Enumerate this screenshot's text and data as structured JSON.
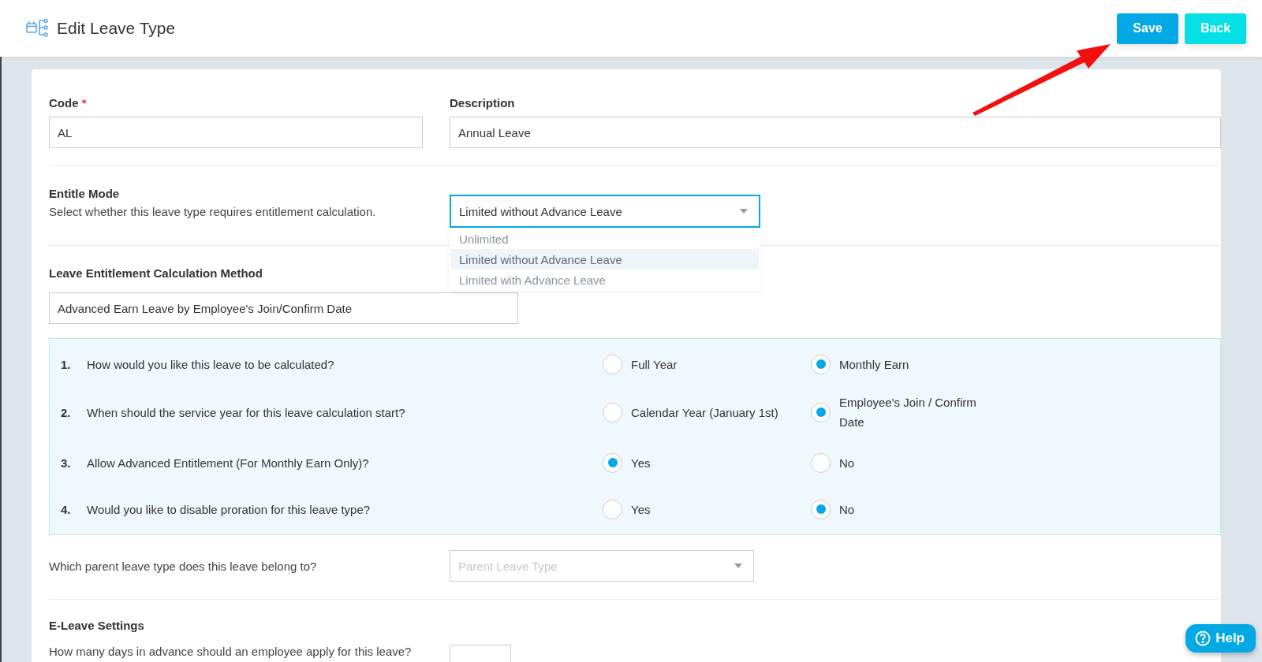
{
  "header": {
    "title": "Edit Leave Type",
    "buttons": [
      {
        "label": "Save",
        "kind": "primary"
      },
      {
        "label": "Back",
        "kind": "secondary"
      }
    ]
  },
  "code": {
    "label": "Code",
    "required_mark": "*",
    "value": "AL"
  },
  "description": {
    "label": "Description",
    "value": "Annual Leave"
  },
  "entitle_mode": {
    "title": "Entitle Mode",
    "hint": "Select whether this leave type requires entitlement calculation.",
    "value": "Limited without Advance Leave",
    "options": [
      {
        "label": "Unlimited",
        "selected": false
      },
      {
        "label": "Limited without Advance Leave",
        "selected": true
      },
      {
        "label": "Limited with Advance Leave",
        "selected": false
      }
    ]
  },
  "calculation_method": {
    "title": "Leave Entitlement Calculation Method",
    "value": "Advanced Earn Leave by Employee's Join/Confirm Date"
  },
  "questions": [
    {
      "number": "1.",
      "text": "How would you like this leave to be calculated?",
      "options": [
        {
          "label": "Full Year",
          "selected": false
        },
        {
          "label": "Monthly Earn",
          "selected": true
        }
      ]
    },
    {
      "number": "2.",
      "text": "When should the service year for this leave calculation start?",
      "options": [
        {
          "label": "Calendar Year (January 1st)",
          "selected": false
        },
        {
          "label": "Employee's Join / Confirm Date",
          "selected": true
        }
      ]
    },
    {
      "number": "3.",
      "text": "Allow Advanced Entitlement (For Monthly Earn Only)?",
      "options": [
        {
          "label": "Yes",
          "selected": true
        },
        {
          "label": "No",
          "selected": false
        }
      ]
    },
    {
      "number": "4.",
      "text": "Would you like to disable proration for this leave type?",
      "options": [
        {
          "label": "Yes",
          "selected": false
        },
        {
          "label": "No",
          "selected": true
        }
      ]
    }
  ],
  "parent_leave": {
    "question": "Which parent leave type does this leave belong to?",
    "placeholder": "Parent Leave Type"
  },
  "e_leave": {
    "title": "E-Leave Settings",
    "question": "How many days in advance should an employee apply for this leave?"
  },
  "help_button": {
    "label": "Help"
  }
}
